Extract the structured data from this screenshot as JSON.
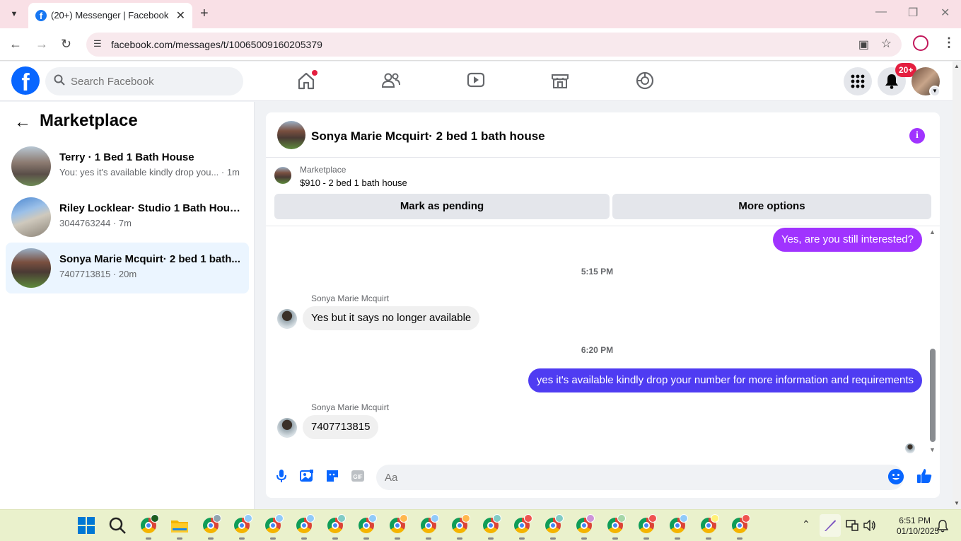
{
  "browser": {
    "tab_title": "(20+) Messenger | Facebook",
    "url": "facebook.com/messages/t/10065009160205379"
  },
  "fb_header": {
    "search_placeholder": "Search Facebook",
    "notif_badge": "20+"
  },
  "left_panel": {
    "title": "Marketplace",
    "conversations": [
      {
        "name": "Terry · 1 Bed 1 Bath House",
        "preview": "You: yes it's available kindly drop you... · 1m",
        "active": false
      },
      {
        "name": "Riley Locklear· Studio 1 Bath House",
        "preview": "3044763244 · 7m",
        "active": false
      },
      {
        "name": "Sonya Marie Mcquirt· 2 bed 1 bath...",
        "preview": "7407713815 · 20m",
        "active": true
      }
    ]
  },
  "chat": {
    "header_name": "Sonya Marie Mcquirt· 2 bed 1 bath house",
    "marketplace_label": "Marketplace",
    "listing": "$910 - 2 bed 1 bath house",
    "btn_pending": "Mark as pending",
    "btn_more": "More options",
    "messages": {
      "out1": "Yes, are you still interested?",
      "ts1": "5:15 PM",
      "sender1": "Sonya Marie Mcquirt",
      "in1": "Yes but it says no longer available",
      "ts2": "6:20 PM",
      "out2": "yes it's available kindly drop your number for more information and requirements",
      "sender2": "Sonya Marie Mcquirt",
      "in2": "7407713815"
    },
    "composer_placeholder": "Aa"
  },
  "taskbar": {
    "time": "6:51 PM",
    "date": "01/10/2025"
  },
  "colors": {
    "fb_blue": "#0866ff",
    "bubble_purple": "#a033ff",
    "bubble_blue": "#4f3cf2",
    "active_conv": "#ebf5ff"
  }
}
